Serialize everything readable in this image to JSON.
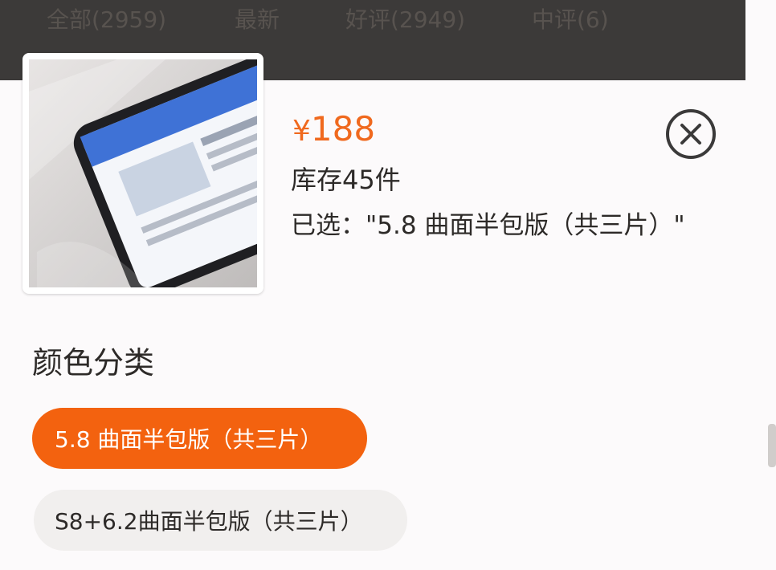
{
  "tabs": [
    {
      "label": "全部(2959)"
    },
    {
      "label": "最新"
    },
    {
      "label": "好评(2949)"
    },
    {
      "label": "中评(6)"
    }
  ],
  "product": {
    "currency_symbol": "¥",
    "price": "188",
    "stock": "库存45件",
    "selected": "已选：\"5.8 曲面半包版（共三片）\"",
    "image_icon": "phone-screen-protector-photo"
  },
  "section": {
    "title": "颜色分类",
    "options": [
      {
        "label": "5.8 曲面半包版（共三片）",
        "selected": true
      },
      {
        "label": "S8+6.2曲面半包版（共三片）",
        "selected": false
      }
    ]
  },
  "colors": {
    "accent": "#f3620f",
    "price": "#f0691e",
    "overlay": "#3c3a39"
  },
  "icons": {
    "close": "close-circle-icon"
  }
}
